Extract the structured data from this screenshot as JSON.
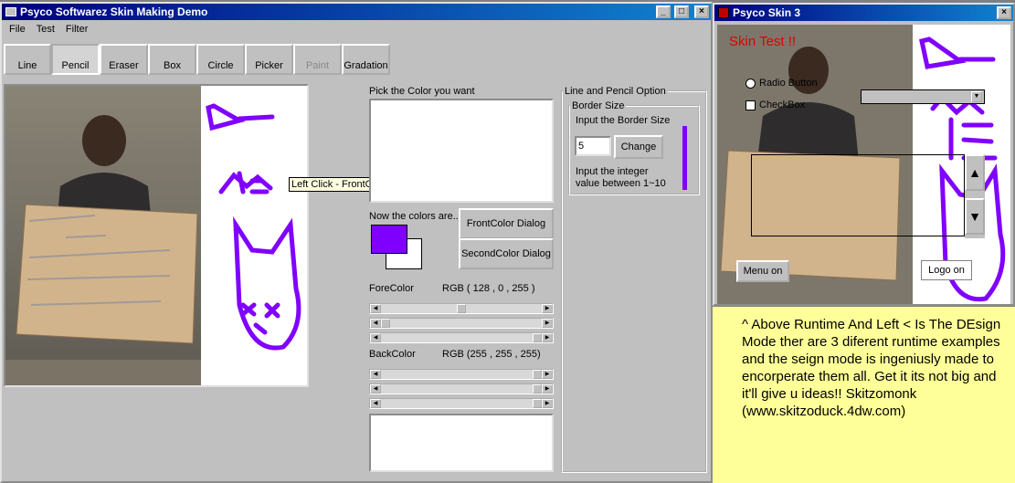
{
  "main_window": {
    "title": "Psyco Softwarez Skin Making Demo",
    "menu": [
      "File",
      "Test",
      "Filter"
    ]
  },
  "tools": [
    "Line",
    "Pencil",
    "Eraser",
    "Box",
    "Circle",
    "Picker",
    "Paint",
    "Gradation"
  ],
  "tooltip": "Left Click - FrontColor, Right Click - BackColor",
  "color_panel": {
    "pick_label": "Pick the Color you want",
    "now_label": "Now the colors are..",
    "front_dialog": "FrontColor Dialog",
    "second_dialog": "SecondColor Dialog",
    "fore_label": "ForeColor",
    "fore_rgb": "RGB ( 128 ,  0 ,  255 )",
    "back_label": "BackColor",
    "back_rgb": "RGB (255 , 255 , 255)",
    "front_color": "#8000ff",
    "back_color": "#ffffff",
    "fore_values": [
      128,
      0,
      255
    ],
    "back_values": [
      255,
      255,
      255
    ]
  },
  "options": {
    "group_title": "Line and Pencil Option",
    "border_title": "Border Size",
    "input_label": "Input the Border Size",
    "input_value": "5",
    "change_button": "Change",
    "hint": "Input the integer value between 1~10"
  },
  "skin_window": {
    "title": "Psyco Skin 3",
    "skin_test": "Skin Test !!",
    "radio_label": "Radio Button",
    "check_label": "CheckBox",
    "menu_button": "Menu on",
    "logo_button": "Logo on"
  },
  "note": {
    "text": "^ Above Runtime And Left < Is The DEsign Mode ther are 3 diferent runtime examples and the seign mode is ingeniusly made to encorperate them all. Get it its not big and it'll give u ideas!! Skitzomonk (www.skitzoduck.4dw.com)"
  }
}
